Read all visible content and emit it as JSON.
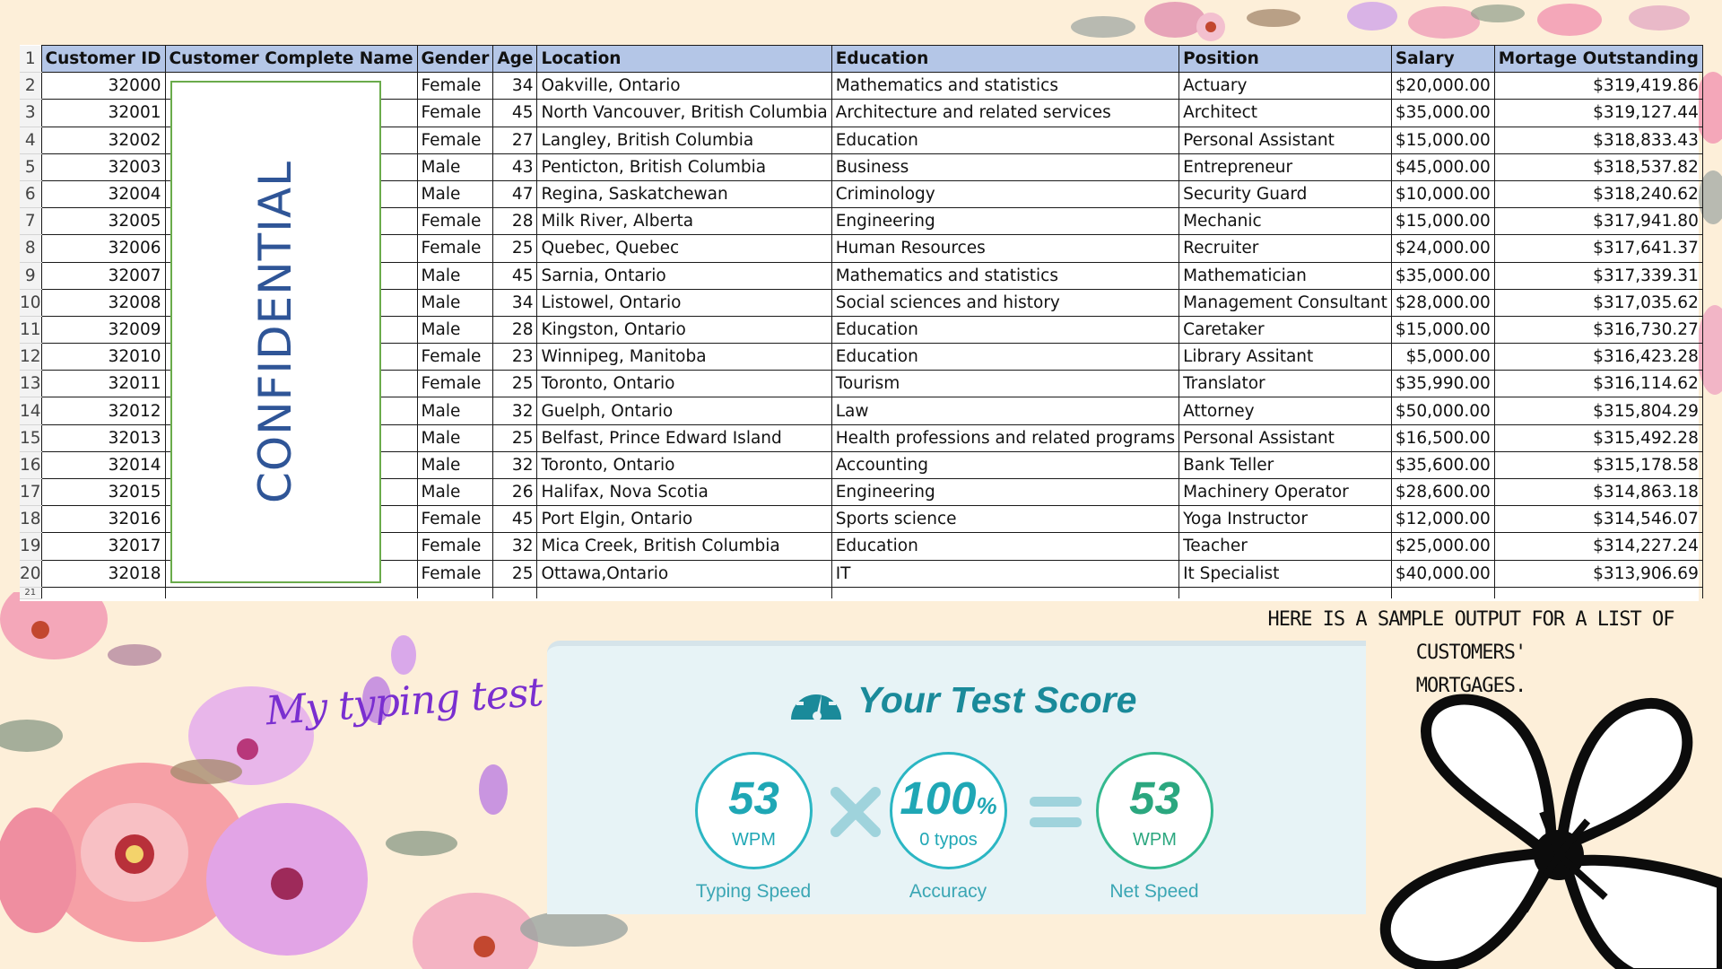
{
  "spreadsheet": {
    "row_numbers": [
      "1",
      "2",
      "3",
      "4",
      "5",
      "6",
      "7",
      "8",
      "9",
      "10",
      "11",
      "12",
      "13",
      "14",
      "15",
      "16",
      "17",
      "18",
      "19",
      "20",
      "21"
    ],
    "headers": [
      "Customer ID",
      "Customer Complete Name",
      "Gender",
      "Age",
      "Location",
      "Education",
      "Position",
      "Salary",
      "Mortage Outstanding"
    ],
    "rows": [
      [
        "32000",
        "",
        "Female",
        "34",
        "Oakville, Ontario",
        "Mathematics and statistics",
        "Actuary",
        "$20,000.00",
        "$319,419.86"
      ],
      [
        "32001",
        "",
        "Female",
        "45",
        "North Vancouver, British Columbia",
        "Architecture and related services",
        "Architect",
        "$35,000.00",
        "$319,127.44"
      ],
      [
        "32002",
        "",
        "Female",
        "27",
        "Langley, British Columbia",
        "Education",
        "Personal Assistant",
        "$15,000.00",
        "$318,833.43"
      ],
      [
        "32003",
        "",
        "Male",
        "43",
        "Penticton, British Columbia",
        "Business",
        "Entrepreneur",
        "$45,000.00",
        "$318,537.82"
      ],
      [
        "32004",
        "",
        "Male",
        "47",
        "Regina, Saskatchewan",
        "Criminology",
        "Security Guard",
        "$10,000.00",
        "$318,240.62"
      ],
      [
        "32005",
        "",
        "Female",
        "28",
        "Milk River, Alberta",
        "Engineering",
        "Mechanic",
        "$15,000.00",
        "$317,941.80"
      ],
      [
        "32006",
        "",
        "Female",
        "25",
        "Quebec, Quebec",
        "Human Resources",
        "Recruiter",
        "$24,000.00",
        "$317,641.37"
      ],
      [
        "32007",
        "",
        "Male",
        "45",
        "Sarnia, Ontario",
        "Mathematics and statistics",
        "Mathematician",
        "$35,000.00",
        "$317,339.31"
      ],
      [
        "32008",
        "",
        "Male",
        "34",
        "Listowel, Ontario",
        "Social sciences and history",
        "Management Consultant",
        "$28,000.00",
        "$317,035.62"
      ],
      [
        "32009",
        "",
        "Male",
        "28",
        "Kingston, Ontario",
        "Education",
        "Caretaker",
        "$15,000.00",
        "$316,730.27"
      ],
      [
        "32010",
        "",
        "Female",
        "23",
        "Winnipeg, Manitoba",
        "Education",
        "Library Assitant",
        "$5,000.00",
        "$316,423.28"
      ],
      [
        "32011",
        "",
        "Female",
        "25",
        "Toronto, Ontario",
        "Tourism",
        "Translator",
        "$35,990.00",
        "$316,114.62"
      ],
      [
        "32012",
        "",
        "Male",
        "32",
        "Guelph, Ontario",
        "Law",
        "Attorney",
        "$50,000.00",
        "$315,804.29"
      ],
      [
        "32013",
        "",
        "Male",
        "25",
        "Belfast, Prince Edward Island",
        "Health professions and related programs",
        "Personal Assistant",
        "$16,500.00",
        "$315,492.28"
      ],
      [
        "32014",
        "",
        "Male",
        "32",
        "Toronto, Ontario",
        "Accounting",
        "Bank Teller",
        "$35,600.00",
        "$315,178.58"
      ],
      [
        "32015",
        "",
        "Male",
        "26",
        "Halifax, Nova Scotia",
        "Engineering",
        "Machinery Operator",
        "$28,600.00",
        "$314,863.18"
      ],
      [
        "32016",
        "",
        "Female",
        "45",
        "Port Elgin, Ontario",
        "Sports science",
        "Yoga Instructor",
        "$12,000.00",
        "$314,546.07"
      ],
      [
        "32017",
        "",
        "Female",
        "32",
        "Mica Creek, British Columbia",
        "Education",
        "Teacher",
        "$25,000.00",
        "$314,227.24"
      ],
      [
        "32018",
        "",
        "Female",
        "25",
        "Ottawa,Ontario",
        "IT",
        "It Specialist",
        "$40,000.00",
        "$313,906.69"
      ]
    ],
    "redaction_label": "CONFIDENTIAL",
    "header_color": "#b4c6e7"
  },
  "caption": {
    "line1": "Here is a sample output for a list of customers'",
    "line2": "mortgages."
  },
  "typing_title": "My typing test result",
  "test_card": {
    "icon": "speedometer-icon",
    "title": "Your Test Score",
    "typing_speed": {
      "value": "53",
      "unit": "WPM",
      "label": "Typing Speed"
    },
    "accuracy": {
      "value": "100",
      "unit": "%",
      "sub": "0  typos",
      "label": "Accuracy"
    },
    "net_speed": {
      "value": "53",
      "unit": "WPM",
      "label": "Net Speed"
    },
    "operator_multiply": "multiply-icon",
    "operator_equals": "equals-icon",
    "colors": {
      "teal": "#1fa7b5",
      "green": "#2ba77f",
      "background": "#e7f3f6"
    }
  },
  "decorations": [
    "pink-flower-cluster",
    "black-outline-flower-icon"
  ]
}
